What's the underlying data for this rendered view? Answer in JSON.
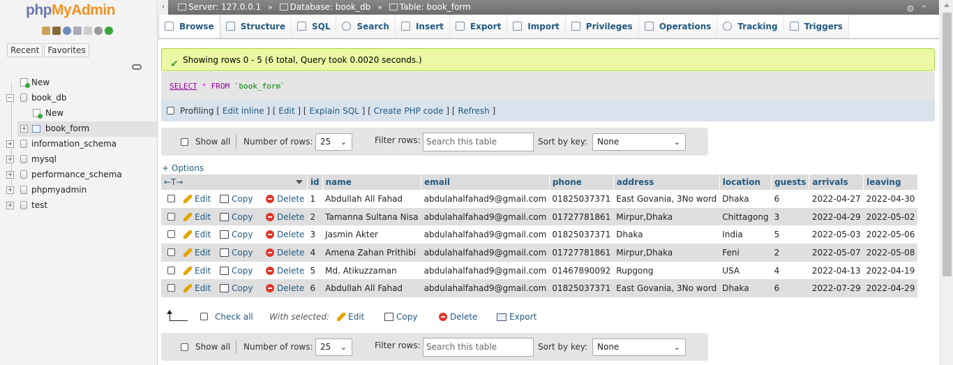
{
  "logo": {
    "php": "php",
    "admin": "MyAdmin"
  },
  "nav": {
    "tabs": [
      "Recent",
      "Favorites"
    ],
    "tree": [
      {
        "label": "New"
      },
      {
        "label": "book_db"
      },
      {
        "label": "New"
      },
      {
        "label": "book_form"
      },
      {
        "label": "information_schema"
      },
      {
        "label": "mysql"
      },
      {
        "label": "performance_schema"
      },
      {
        "label": "phpmyadmin"
      },
      {
        "label": "test"
      }
    ]
  },
  "breadcrumb": {
    "server": "Server: 127.0.0.1",
    "database": "Database: book_db",
    "table": "Table: book_form",
    "sep": "»"
  },
  "tabs": [
    "Browse",
    "Structure",
    "SQL",
    "Search",
    "Insert",
    "Export",
    "Import",
    "Privileges",
    "Operations",
    "Tracking",
    "Triggers"
  ],
  "message": "Showing rows 0 - 5 (6 total, Query took 0.0020 seconds.)",
  "sql": {
    "select": "SELECT",
    "star": "*",
    "from": "FROM",
    "table": "`book_form`"
  },
  "profiling": {
    "label": "Profiling",
    "links": [
      "Edit inline",
      "Edit",
      "Explain SQL",
      "Create PHP code",
      "Refresh"
    ]
  },
  "navbar": {
    "show_all": "Show all",
    "rows_label": "Number of rows:",
    "rows_value": "25",
    "filter_label": "Filter rows:",
    "filter_placeholder": "Search this table",
    "sort_label": "Sort by key:",
    "sort_value": "None"
  },
  "options_link": "+ Options",
  "table": {
    "arrows": "←T→",
    "columns": [
      "id",
      "name",
      "email",
      "phone",
      "address",
      "location",
      "guests",
      "arrivals",
      "leaving"
    ],
    "actions": {
      "edit": "Edit",
      "copy": "Copy",
      "delete": "Delete"
    },
    "rows": [
      [
        "1",
        "Abdullah All Fahad",
        "abdulahalfahad9@gmail.com",
        "01825037371",
        "East Govania, 3No word",
        "Dhaka",
        "6",
        "2022-04-27",
        "2022-04-30"
      ],
      [
        "2",
        "Tamanna Sultana Nisa",
        "abdulahalfahad9@gmail.com",
        "01727781861",
        "Mirpur,Dhaka",
        "Chittagong",
        "3",
        "2022-04-29",
        "2022-05-02"
      ],
      [
        "3",
        "Jasmin Akter",
        "abdulahalfahad9@gmail.com",
        "01825037371",
        "Dhaka",
        "India",
        "5",
        "2022-05-03",
        "2022-05-06"
      ],
      [
        "4",
        "Amena Zahan Prithibi",
        "abdulahalfahad9@gmail.com",
        "01727781861",
        "Mirpur,Dhaka",
        "Feni",
        "2",
        "2022-05-07",
        "2022-05-08"
      ],
      [
        "5",
        "Md. Atikuzzaman",
        "abdulahalfahad9@gmail.com",
        "01467890092",
        "Rupgong",
        "USA",
        "4",
        "2022-04-13",
        "2022-04-19"
      ],
      [
        "6",
        "Abdullah All Fahad",
        "abdulahalfahad9@gmail.com",
        "01825037371",
        "East Govania, 3No word",
        "Dhaka",
        "6",
        "2022-07-29",
        "2022-04-29"
      ]
    ]
  },
  "bulk": {
    "check_all": "Check all",
    "with_selected": "With selected:",
    "edit": "Edit",
    "copy": "Copy",
    "delete": "Delete",
    "export": "Export"
  }
}
